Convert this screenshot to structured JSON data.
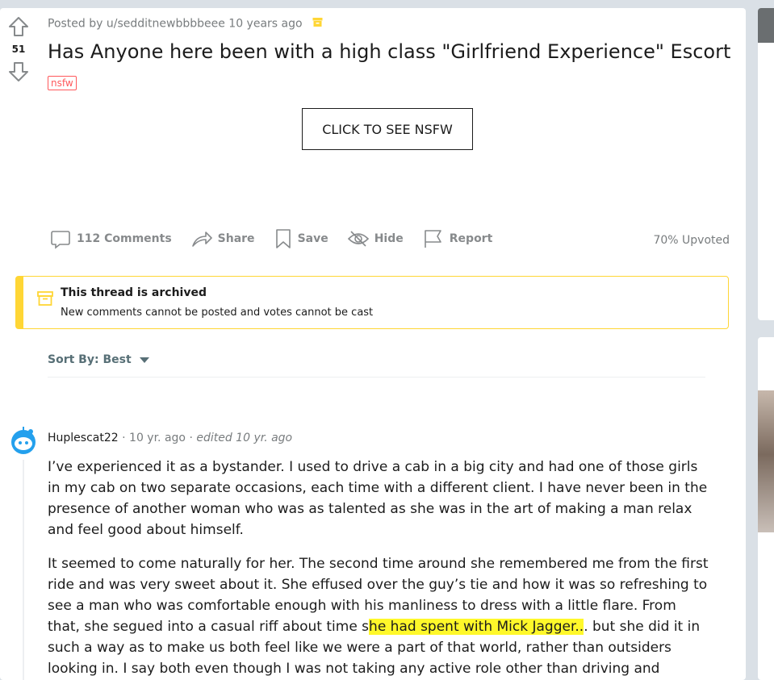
{
  "post": {
    "votes": "51",
    "meta": "Posted by u/sedditnewbbbbeee 10 years ago",
    "title": "Has Anyone here been with a high class \"Girlfriend Experience\" Escort",
    "nsfw_tag": "nsfw",
    "nsfw_button": "CLICK TO SEE NSFW",
    "actions": {
      "comments": "112 Comments",
      "share": "Share",
      "save": "Save",
      "hide": "Hide",
      "report": "Report"
    },
    "upvoted": "70% Upvoted"
  },
  "archived": {
    "title": "This thread is archived",
    "subtitle": "New comments cannot be posted and votes cannot be cast"
  },
  "sort": {
    "label": "Sort By: Best"
  },
  "comment": {
    "author": "Huplescat22",
    "time": "10 yr. ago",
    "edited": "edited 10 yr. ago",
    "p1": "I’ve experienced it as a bystander. I used to drive a cab in a big city and had one of those girls in my cab on two separate occasions, each time with a different client. I have never been in the presence of another woman who was as talented as she was in the art of making a man relax and feel good about himself.",
    "p2_before": "It seemed to come naturally for her. The second time around she remembered me from the first ride and was very sweet about it. She effused over the guy’s tie and how it was so refreshing to see a man who was comfortable enough with his manliness to dress with a little flare. From that, she segued into a casual riff about time s",
    "p2_highlight": "he had spent with Mick Jagger..",
    "p2_after": ". but she did it in such a way as to make us both feel like we were a part of that world, rather than outsiders looking in. I say both even though I was not taking any active role other than driving and keeping my mouth shut."
  },
  "colors": {
    "accent_yellow": "#ffd635",
    "nsfw_red": "#ff585b",
    "highlight": "#fff82a"
  }
}
